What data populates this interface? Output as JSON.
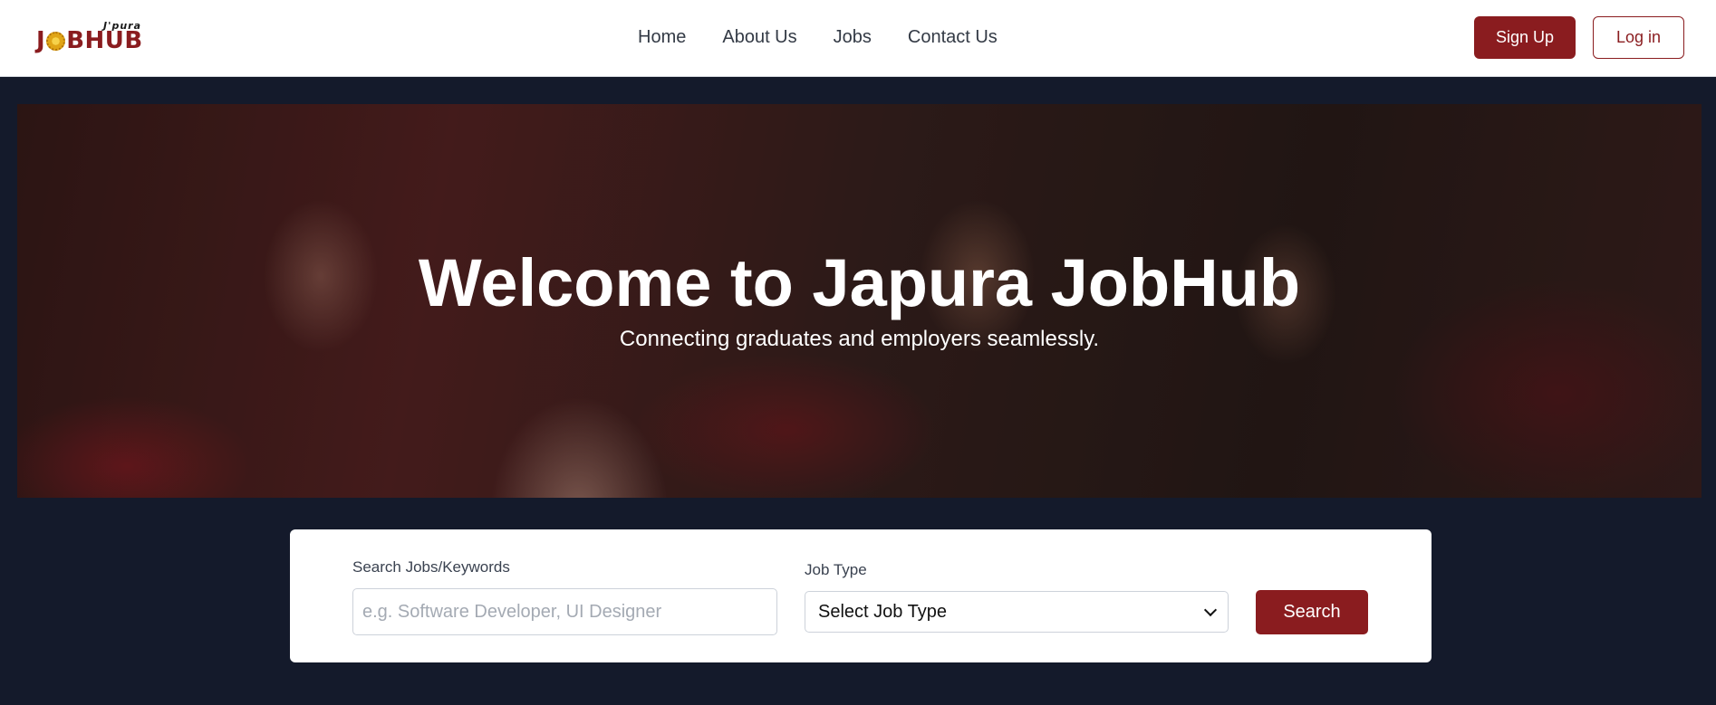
{
  "brand": {
    "logo_small": "J'pura",
    "logo_part1": "J",
    "logo_part2": "BHUB"
  },
  "nav": {
    "items": [
      {
        "label": "Home"
      },
      {
        "label": "About Us"
      },
      {
        "label": "Jobs"
      },
      {
        "label": "Contact Us"
      }
    ]
  },
  "auth": {
    "signup_label": "Sign Up",
    "login_label": "Log in"
  },
  "hero": {
    "title": "Welcome to Japura JobHub",
    "subtitle": "Connecting graduates and employers seamlessly."
  },
  "search": {
    "keyword_label": "Search Jobs/Keywords",
    "keyword_placeholder": "e.g. Software Developer, UI Designer",
    "keyword_value": "",
    "type_label": "Job Type",
    "type_selected": "Select Job Type",
    "button_label": "Search"
  },
  "colors": {
    "brand_maroon": "#8a1c1f",
    "page_bg": "#141a2b",
    "logo_gold": "#e0a516"
  }
}
